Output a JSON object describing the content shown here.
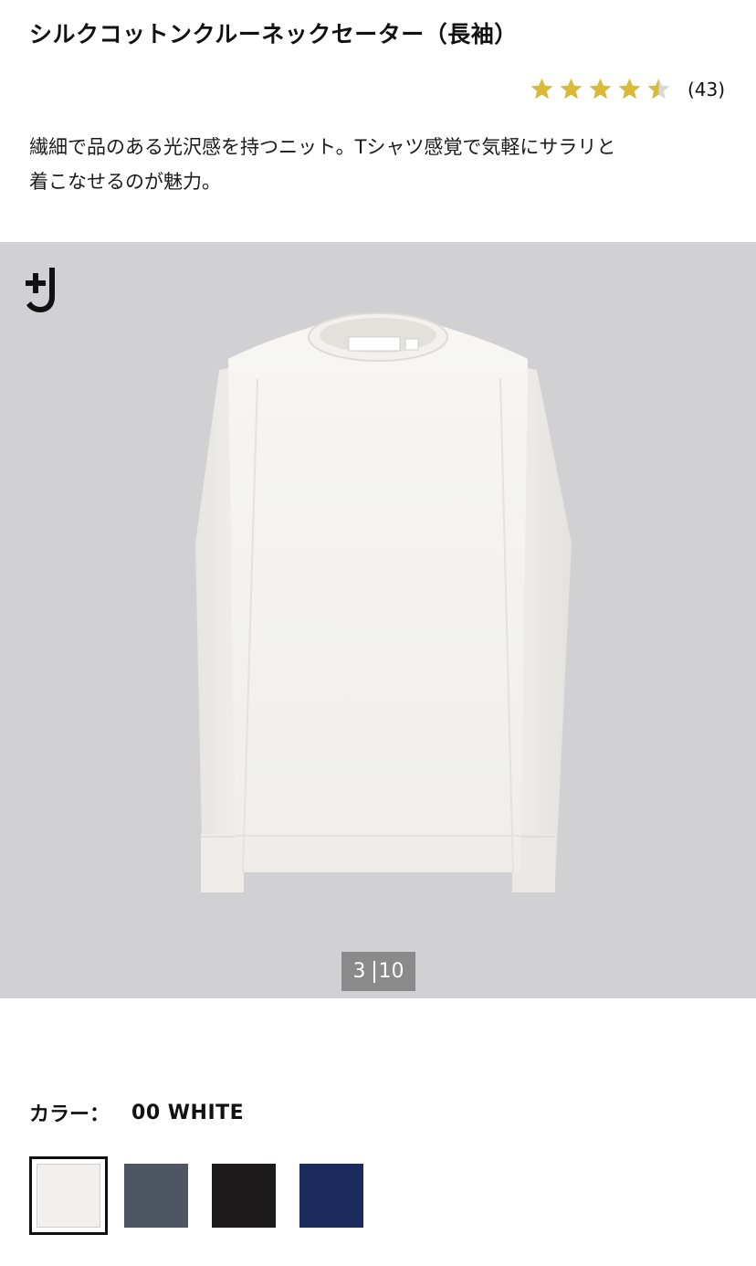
{
  "product": {
    "title": "シルクコットンクルーネックセーター（長袖）",
    "rating": 4.5,
    "review_count": "(43)",
    "description_line1": "繊細で品のある光沢感を持つニット。Tシャツ感覚で気軽にサラリと",
    "description_line2": "着こなせるのが魅力。"
  },
  "colors": {
    "star": "#d9b93a",
    "star_empty": "#d8d8d8",
    "gallery_bg": "#d1d1d4"
  },
  "gallery": {
    "brand_icon": "plus-j-logo-icon",
    "current": "3",
    "total": "10"
  },
  "color_selector": {
    "label": "カラー：",
    "selected_value": "00 WHITE",
    "swatches": [
      {
        "name": "white",
        "color": "#f1f0ee",
        "selected": true
      },
      {
        "name": "gray",
        "color": "#4e5663",
        "selected": false
      },
      {
        "name": "black",
        "color": "#1c1a1b",
        "selected": false
      },
      {
        "name": "navy",
        "color": "#1c2b5d",
        "selected": false
      }
    ]
  }
}
